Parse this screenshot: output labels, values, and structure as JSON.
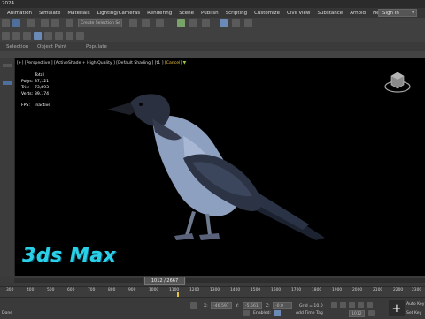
{
  "app": {
    "title": "2024"
  },
  "menu": {
    "items": [
      "Animation",
      "Simulate",
      "Materials",
      "Lighting/Cameras",
      "Rendering",
      "Scene",
      "Publish",
      "Scripting",
      "Customize",
      "Civil View",
      "Substance",
      "Arnold",
      "Help"
    ],
    "sign_in": "Sign In"
  },
  "toolbar": {
    "selection_set_placeholder": "Create Selection Se"
  },
  "ribbon": {
    "tabs": [
      "Selection",
      "Object Paint",
      "Populate"
    ]
  },
  "viewport": {
    "label": "[+] [Perspective ] [ActiveShade + High Quality ] [Default Shading ] [t1 ]",
    "cancel": "[Cancel]",
    "stats": {
      "header": "Total",
      "polys_label": "Polys:",
      "polys_value": "37,121",
      "tris_label": "Tris:",
      "tris_value": "73,893",
      "verts_label": "Verts:",
      "verts_value": "39,174",
      "fps_label": "FPS:",
      "fps_value": "Inactive"
    },
    "watermark": "3ds Max"
  },
  "timeline": {
    "frame": "1012 / 2667",
    "ticks": [
      "300",
      "400",
      "500",
      "600",
      "700",
      "800",
      "900",
      "1000",
      "1100",
      "1200",
      "1300",
      "1400",
      "1500",
      "1600",
      "1700",
      "1800",
      "1900",
      "2000",
      "2100",
      "2200",
      "2300"
    ]
  },
  "statusbar": {
    "left_label": "Done",
    "x_label": "X:",
    "x_value": "-46.597",
    "y_label": "Y:",
    "y_value": "-5.561",
    "z_label": "Z:",
    "z_value": "-0.0",
    "grid": "Grid = 10.0",
    "enabled_label": "Enabled:",
    "add_time_tag": "Add Time Tag",
    "frame_field": "1012",
    "auto_key": "Auto Key",
    "set_key": "Set Key"
  },
  "colors": {
    "accent_cyan": "#2ad0e8",
    "cancel_yellow": "#e8c040",
    "viewport_bg": "#000000"
  }
}
